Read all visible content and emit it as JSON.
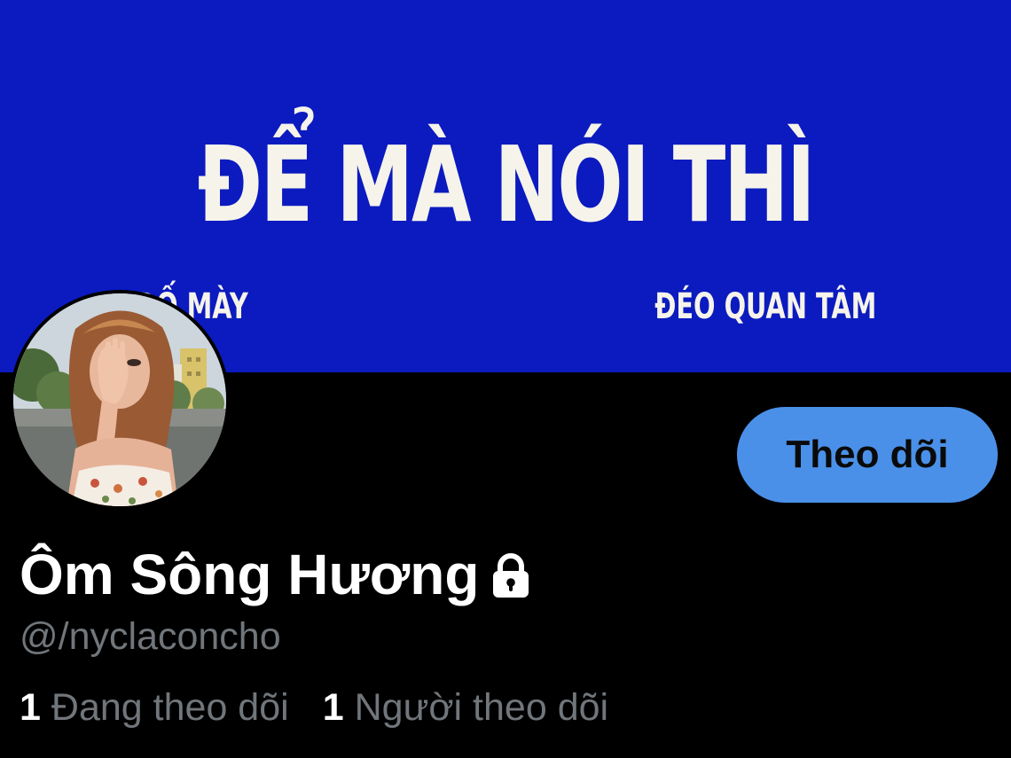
{
  "banner": {
    "headline": "ĐỂ MÀ NÓI THÌ",
    "caption_left": "ĐỐ MÀY",
    "caption_right": "ĐÉO QUAN TÂM",
    "background_color": "#0b1bbf"
  },
  "profile": {
    "display_name": "Ôm Sông Hương",
    "protected_icon": "lock-icon",
    "handle": "@/nyclaconcho",
    "follow_button_label": "Theo dõi",
    "follow_button_color": "#4a90e8",
    "stats": {
      "following_count": "1",
      "following_label": "Đang theo dõi",
      "followers_count": "1",
      "followers_label": "Người theo dõi"
    }
  },
  "colors": {
    "background": "#000000",
    "primary_text": "#ffffff",
    "secondary_text": "#71767b"
  }
}
